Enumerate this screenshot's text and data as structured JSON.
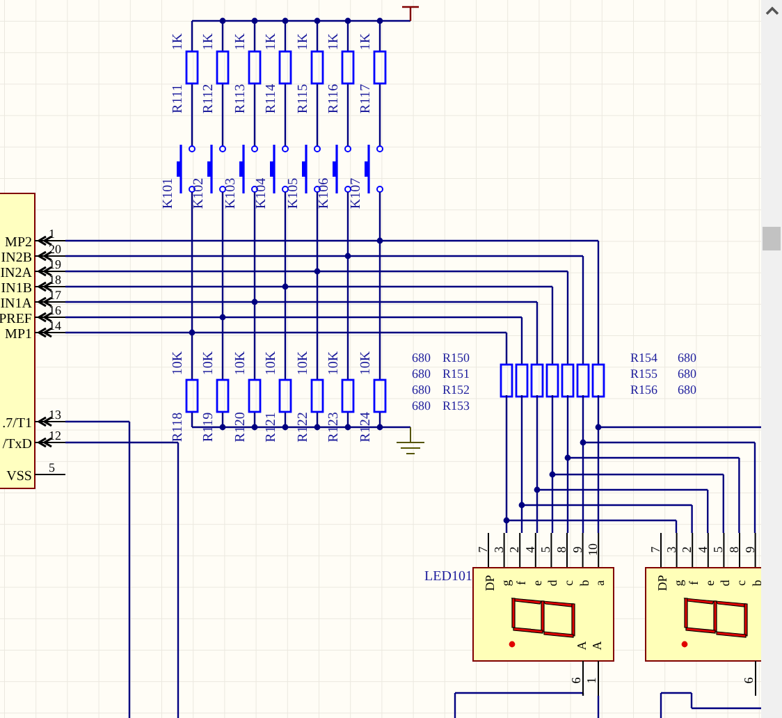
{
  "schematic": {
    "chip": {
      "pins": [
        {
          "name": "MP2",
          "number": "1",
          "kind": "io"
        },
        {
          "name": "IN2B",
          "number": "20",
          "kind": "io"
        },
        {
          "name": "IN2A",
          "number": "19",
          "kind": "io"
        },
        {
          "name": "IN1B",
          "number": "18",
          "kind": "io"
        },
        {
          "name": "IN1A",
          "number": "17",
          "kind": "io"
        },
        {
          "name": "PREF",
          "number": "16",
          "kind": "io"
        },
        {
          "name": "MP1",
          "number": "14",
          "kind": "io"
        },
        {
          "name": ".7/T1",
          "number": "13",
          "kind": "io"
        },
        {
          "name": "/TxD",
          "number": "12",
          "kind": "io"
        },
        {
          "name": "VSS",
          "number": "5",
          "kind": "power"
        }
      ]
    },
    "pullup_resistors": [
      {
        "ref": "R111",
        "value": "1K"
      },
      {
        "ref": "R112",
        "value": "1K"
      },
      {
        "ref": "R113",
        "value": "1K"
      },
      {
        "ref": "R114",
        "value": "1K"
      },
      {
        "ref": "R115",
        "value": "1K"
      },
      {
        "ref": "R116",
        "value": "1K"
      },
      {
        "ref": "R117",
        "value": "1K"
      }
    ],
    "switches": [
      {
        "ref": "K101"
      },
      {
        "ref": "K102"
      },
      {
        "ref": "K103"
      },
      {
        "ref": "K104"
      },
      {
        "ref": "K105"
      },
      {
        "ref": "K106"
      },
      {
        "ref": "K107"
      }
    ],
    "pulldown_resistors": [
      {
        "ref": "R118",
        "value": "10K"
      },
      {
        "ref": "R119",
        "value": "10K"
      },
      {
        "ref": "R120",
        "value": "10K"
      },
      {
        "ref": "R121",
        "value": "10K"
      },
      {
        "ref": "R122",
        "value": "10K"
      },
      {
        "ref": "R123",
        "value": "10K"
      },
      {
        "ref": "R124",
        "value": "10K"
      }
    ],
    "segment_resistors": [
      {
        "ref": "R150",
        "value": "680"
      },
      {
        "ref": "R151",
        "value": "680"
      },
      {
        "ref": "R152",
        "value": "680"
      },
      {
        "ref": "R153",
        "value": "680"
      },
      {
        "ref": "R154",
        "value": "680"
      },
      {
        "ref": "R155",
        "value": "680"
      },
      {
        "ref": "R156",
        "value": "680"
      }
    ],
    "displays": [
      {
        "ref": "LED101",
        "top_pins": [
          "7",
          "3",
          "2",
          "4",
          "5",
          "8",
          "9",
          "10"
        ],
        "segments": [
          "DP",
          "g",
          "f",
          "e",
          "d",
          "c",
          "b",
          "a"
        ],
        "anodes": [
          "A",
          "A"
        ],
        "bottom_pins": [
          "6",
          "1"
        ]
      },
      {
        "top_pins": [
          "7",
          "3",
          "2",
          "4",
          "5",
          "8",
          "9"
        ],
        "segments": [
          "DP",
          "g",
          "f",
          "e",
          "d",
          "c",
          "b"
        ],
        "bottom_pins": [
          "6"
        ]
      }
    ]
  }
}
